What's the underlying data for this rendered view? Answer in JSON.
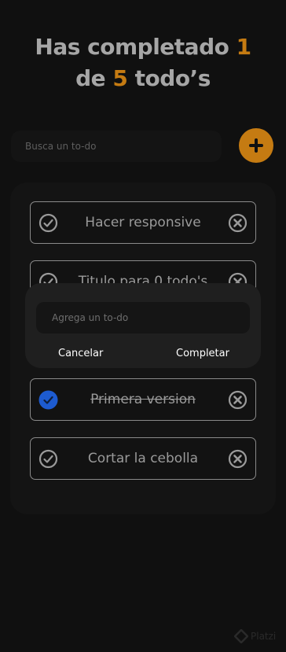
{
  "header": {
    "prefix": "Has completado",
    "completed": "1",
    "middle": "de",
    "total": "5",
    "suffix": "todo’s",
    "accent_color": "#c57b12"
  },
  "search": {
    "placeholder": "Busca un to-do",
    "value": ""
  },
  "add_button": {
    "icon": "plus-icon"
  },
  "todos": [
    {
      "text": "Hacer responsive",
      "completed": false
    },
    {
      "text": "Titulo para 0 todo's",
      "completed": false
    },
    {
      "text": "Primera version",
      "completed": true
    },
    {
      "text": "Cortar la cebolla",
      "completed": false
    }
  ],
  "modal": {
    "placeholder": "Agrega un to-do",
    "cancel_label": "Cancelar",
    "complete_label": "Completar"
  },
  "watermark": {
    "text": "Platzi"
  },
  "colors": {
    "background": "#101010",
    "check_done": "#1d5bd0"
  }
}
